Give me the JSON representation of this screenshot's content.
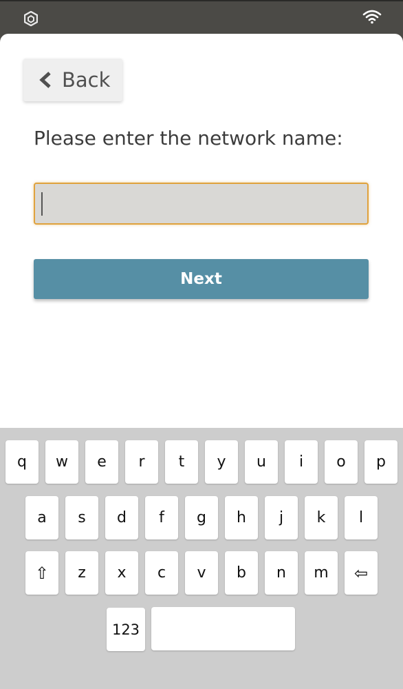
{
  "status_bar": {
    "logo_icon": "app-logo-icon",
    "wifi_icon": "wifi-icon"
  },
  "header": {
    "back_label": "Back",
    "back_icon": "chevron-left-icon"
  },
  "form": {
    "prompt": "Please enter the network name:",
    "network_name_value": "",
    "next_label": "Next"
  },
  "colors": {
    "status_bar": "#4b4a46",
    "accent_button": "#568fa5",
    "input_focus_border": "#e0a23d",
    "keyboard_bg": "#cdcdcd"
  },
  "keyboard": {
    "row1": [
      "q",
      "w",
      "e",
      "r",
      "t",
      "y",
      "u",
      "i",
      "o",
      "p"
    ],
    "row2": [
      "a",
      "s",
      "d",
      "f",
      "g",
      "h",
      "j",
      "k",
      "l"
    ],
    "row3": [
      "⇧",
      "z",
      "x",
      "c",
      "v",
      "b",
      "n",
      "m",
      "⇦"
    ],
    "mode_label": "123",
    "space_label": ""
  }
}
